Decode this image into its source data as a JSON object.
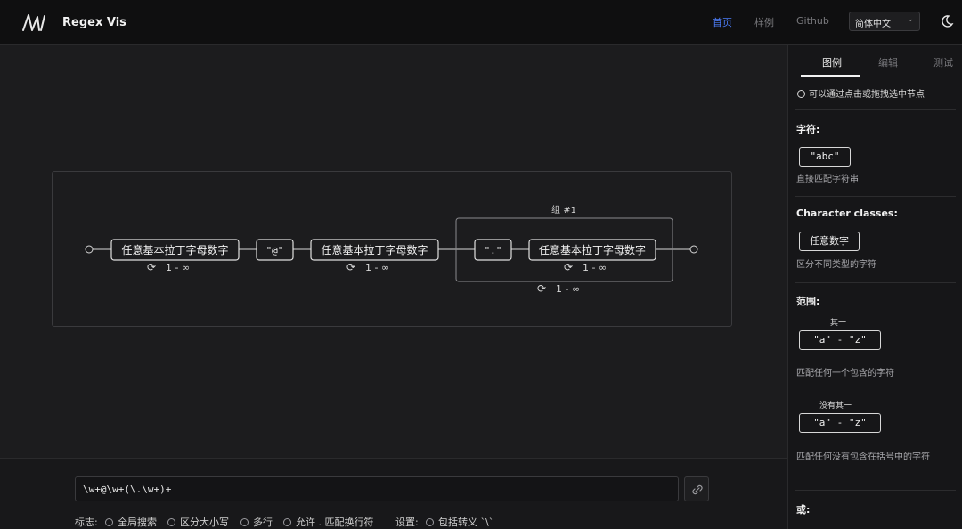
{
  "header": {
    "app_title": "Regex Vis",
    "nav": [
      {
        "label": "首页",
        "active": true
      },
      {
        "label": "样例",
        "active": false
      },
      {
        "label": "Github",
        "active": false
      }
    ],
    "language": "简体中文",
    "accent_color": "#4b7bf5"
  },
  "diagram": {
    "group_label": "组 #1",
    "nodes": {
      "n1": "任意基本拉丁字母数字",
      "n2": "\"@\"",
      "n3": "任意基本拉丁字母数字",
      "n4": "\".\"",
      "n5": "任意基本拉丁字母数字"
    },
    "quantifier": "1 - ∞"
  },
  "editor": {
    "regex": "\\w+@\\w+(\\.\\w+)+",
    "flags_label": "标志:",
    "flags": [
      "全局搜索",
      "区分大小写",
      "多行",
      "允许 . 匹配换行符"
    ],
    "settings_label": "设置:",
    "settings": [
      "包括转义 `\\`"
    ]
  },
  "side": {
    "tabs": [
      "图例",
      "编辑",
      "测试"
    ],
    "hint": "可以通过点击或拖拽选中节点",
    "sections": {
      "chars": {
        "title": "字符:",
        "chip": "\"abc\"",
        "desc": "直接匹配字符串"
      },
      "classes": {
        "title": "Character classes:",
        "chip": "任意数字",
        "desc": "区分不同类型的字符"
      },
      "range": {
        "title": "范围:",
        "one_of_label": "其一",
        "one_of_chip": "\"a\" - \"z\"",
        "one_of_desc": "匹配任何一个包含的字符",
        "none_of_label": "没有其一",
        "none_of_chip": "\"a\" - \"z\"",
        "none_of_desc": "匹配任何没有包含在括号中的字符"
      },
      "or": {
        "title": "或:"
      }
    }
  }
}
